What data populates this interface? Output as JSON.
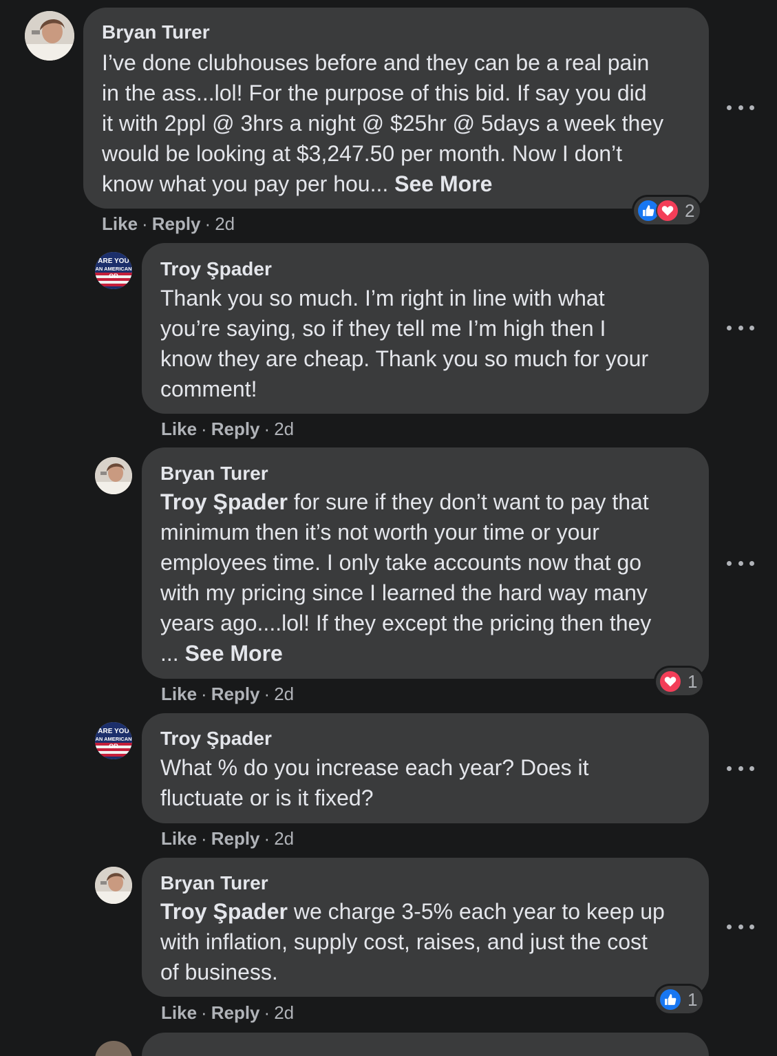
{
  "comments": [
    {
      "author": "Bryan Turer",
      "lines": [
        "I’ve done clubhouses before and they can be a real pain",
        "in the ass...lol! For the purpose of this bid. If say you did",
        "it with 2ppl @ 3hrs a night @ $25hr @ 5days a week they",
        "would be looking at $3,247.50 per month. Now I don’t",
        "know what you pay per hou..."
      ],
      "see_more": "See More",
      "like": "Like",
      "reply": "Reply",
      "time": "2d",
      "reaction_count": "2"
    },
    {
      "author": "Troy Şpader",
      "lines": [
        "Thank you so much. I’m right in line with what",
        "you’re saying, so if they tell me I’m high then I",
        "know they are cheap. Thank you so much for your",
        "comment!"
      ],
      "like": "Like",
      "reply": "Reply",
      "time": "2d"
    },
    {
      "author": "Bryan Turer",
      "mention": "Troy Şpader",
      "first_line_rest": " for sure if they don’t want to pay that",
      "lines": [
        "minimum then it’s not worth your time or your",
        "employees time. I only take accounts now that go",
        "with my pricing since I learned the hard way many",
        "years ago....lol! If they except the pricing then they"
      ],
      "last_line_prefix": "... ",
      "see_more": "See More",
      "like": "Like",
      "reply": "Reply",
      "time": "2d",
      "reaction_count": "1"
    },
    {
      "author": "Troy Şpader",
      "lines": [
        "What % do you increase each year? Does it",
        "fluctuate or is it fixed?"
      ],
      "like": "Like",
      "reply": "Reply",
      "time": "2d"
    },
    {
      "author": "Bryan Turer",
      "mention": "Troy Şpader",
      "first_line_rest": " we charge 3-5% each year to keep up",
      "lines": [
        "with inflation, supply cost, raises, and just the cost",
        "of business."
      ],
      "like": "Like",
      "reply": "Reply",
      "time": "2d",
      "reaction_count": "1"
    }
  ],
  "avatar_badge": {
    "line1": "ARE YOU",
    "line2": "AN AMERICAN",
    "line3": "OR"
  },
  "colors": {
    "background": "#18191a",
    "bubble": "#3a3b3c",
    "text": "#e4e6eb",
    "secondary": "#b0b3b8",
    "like_blue": "#1877f2",
    "love_red": "#f33e58"
  },
  "icons": [
    "more-options-icon",
    "like-reaction-icon",
    "love-reaction-icon"
  ]
}
